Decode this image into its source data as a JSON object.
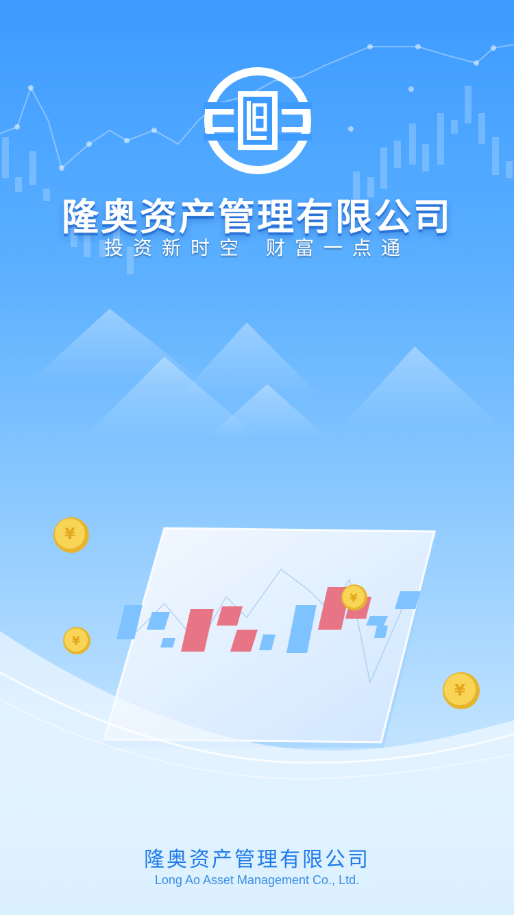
{
  "company": {
    "name": "隆奥资产管理有限公司",
    "slogan_part1": "投资新时空",
    "slogan_part2": "财富一点通"
  },
  "footer": {
    "name": "隆奥资产管理有限公司",
    "english_name": "Long Ao Asset Management Co., Ltd."
  },
  "icons": [
    "company-logo-icon",
    "candlestick-background",
    "mountain-illustration",
    "chart-screen-illustration",
    "gold-coin-icon"
  ],
  "colors": {
    "background_top": "#3d9bff",
    "background_bottom": "#cdebff",
    "title_text": "#ffffff",
    "footer_text": "#1f7bea",
    "candle_up": "#e87585",
    "candle_down": "#7ec3ff",
    "coin": "#f5c842"
  }
}
